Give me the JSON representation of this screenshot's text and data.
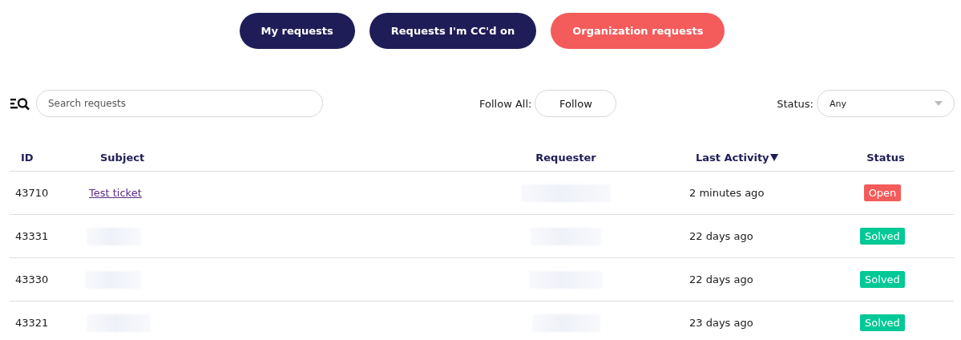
{
  "tabs": [
    {
      "label": "My requests",
      "selected": false
    },
    {
      "label": "Requests I'm CC'd on",
      "selected": false
    },
    {
      "label": "Organization requests",
      "selected": true
    }
  ],
  "search": {
    "placeholder": "Search requests"
  },
  "follow": {
    "label": "Follow All:",
    "button": "Follow"
  },
  "status_filter": {
    "label": "Status:",
    "value": "Any"
  },
  "table": {
    "columns": [
      {
        "label": "ID",
        "sorted": false
      },
      {
        "label": "Subject",
        "sorted": false
      },
      {
        "label": "Requester",
        "sorted": false
      },
      {
        "label": "Last Activity",
        "sorted": true
      },
      {
        "label": "Status",
        "sorted": false
      }
    ],
    "rows": [
      {
        "id": "43710",
        "subject": {
          "kind": "link",
          "text": "Test ticket"
        },
        "requester": {
          "kind": "redacted"
        },
        "last_activity": "2 minutes ago",
        "status": {
          "label": "Open",
          "color": "#f45b5b"
        }
      },
      {
        "id": "43331",
        "subject": {
          "kind": "redacted"
        },
        "requester": {
          "kind": "redacted"
        },
        "last_activity": "22 days ago",
        "status": {
          "label": "Solved",
          "color": "#00c896"
        }
      },
      {
        "id": "43330",
        "subject": {
          "kind": "redacted"
        },
        "requester": {
          "kind": "redacted"
        },
        "last_activity": "22 days ago",
        "status": {
          "label": "Solved",
          "color": "#00c896"
        }
      },
      {
        "id": "43321",
        "subject": {
          "kind": "redacted"
        },
        "requester": {
          "kind": "redacted"
        },
        "last_activity": "23 days ago",
        "status": {
          "label": "Solved",
          "color": "#00c896"
        }
      }
    ]
  }
}
